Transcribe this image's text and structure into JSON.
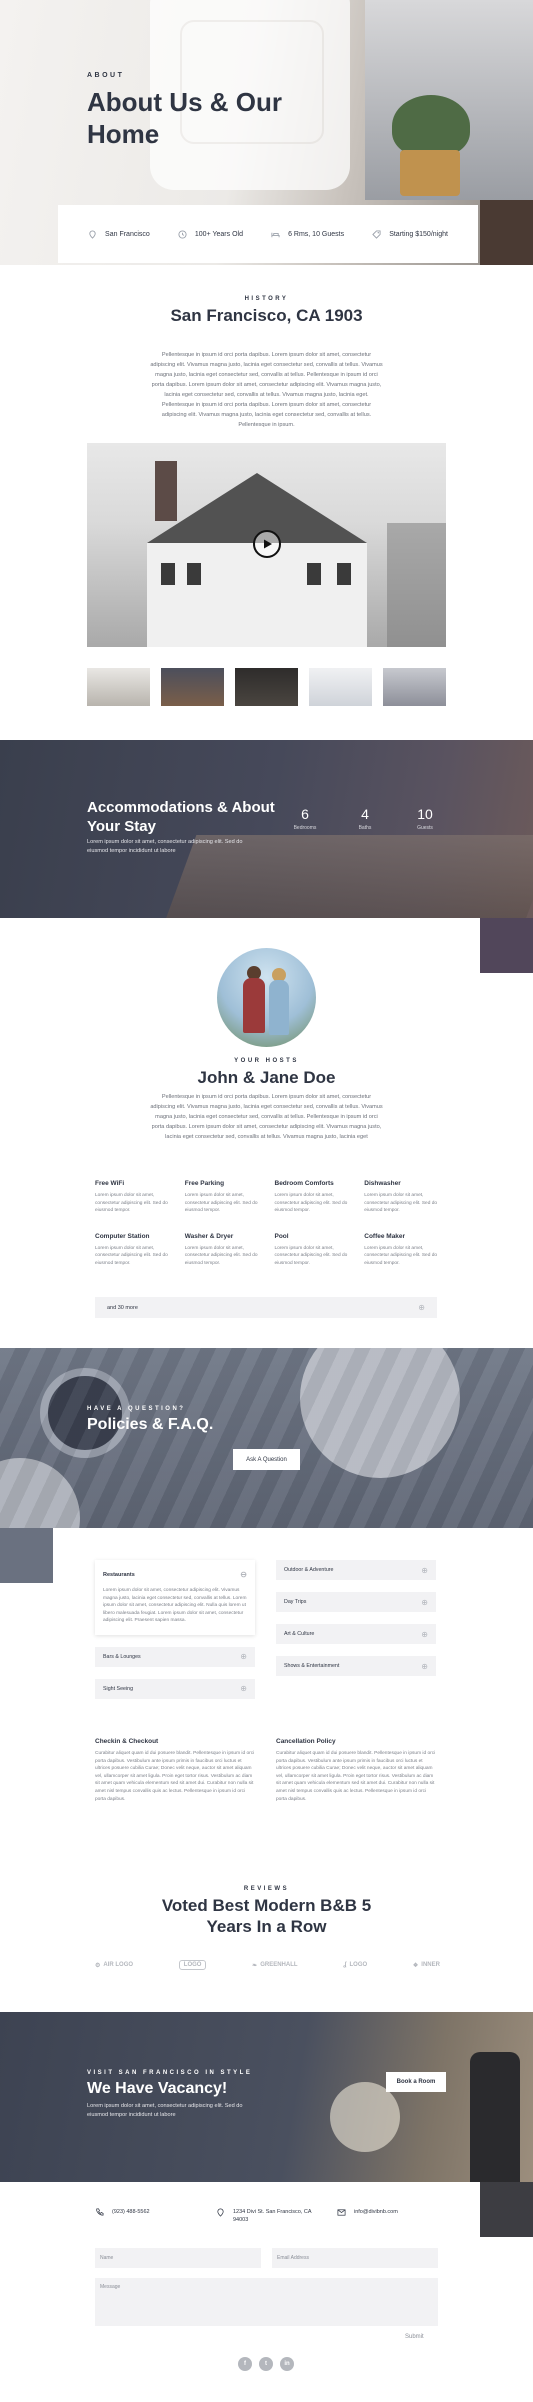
{
  "hero": {
    "overline": "ABOUT",
    "title": "About Us & Our Home"
  },
  "infobar": {
    "items": [
      {
        "icon": "map-pin-icon",
        "label": "San Francisco"
      },
      {
        "icon": "clock-icon",
        "label": "100+ Years Old"
      },
      {
        "icon": "bed-icon",
        "label": "6 Rms, 10 Guests"
      },
      {
        "icon": "tag-icon",
        "label": "Starting $150/night"
      }
    ]
  },
  "history": {
    "overline": "HISTORY",
    "title": "San Francisco, CA 1903",
    "paragraph": "Pellentesque in ipsum id orci porta dapibus. Lorem ipsum dolor sit amet, consectetur adipiscing elit. Vivamus magna justo, lacinia eget consectetur sed, convallis at tellus. Vivamus magna justo, lacinia eget consectetur sed, convallis at tellus. Pellentesque in ipsum id orci porta dapibus. Lorem ipsum dolor sit amet, consectetur adipiscing elit. Vivamus magna justo, lacinia eget consectetur sed, convallis at tellus. Vivamus magna justo, lacinia eget. Pellentesque in ipsum id orci porta dapibus. Lorem ipsum dolor sit amet, consectetur adipiscing elit. Vivamus magna justo, lacinia eget consectetur sed, convallis at tellus. Pellentesque in ipsum."
  },
  "gallery_colors": [
    "#b8b4ad",
    "#7a5e49",
    "#4a4540",
    "#cfd3d9",
    "#8d8f99"
  ],
  "accommodations": {
    "title": "Accommodations & About Your Stay",
    "paragraph": "Lorem ipsum dolor sit amet, consectetur adipiscing elit. Sed do eiusmod tempor incididunt ut labore",
    "stats": [
      {
        "number": "6",
        "label": "Bedrooms"
      },
      {
        "number": "4",
        "label": "Baths"
      },
      {
        "number": "10",
        "label": "Guests"
      }
    ]
  },
  "hosts": {
    "overline": "YOUR HOSTS",
    "title": "John & Jane Doe",
    "paragraph": "Pellentesque in ipsum id orci porta dapibus. Lorem ipsum dolor sit amet, consectetur adipiscing elit. Vivamus magna justo, lacinia eget consectetur sed, convallis at tellus. Vivamus magna justo, lacinia eget consectetur sed, convallis at tellus. Pellentesque in ipsum id orci porta dapibus. Lorem ipsum dolor sit amet, consectetur adipiscing elit. Vivamus magna justo, lacinia eget consectetur sed, convallis at tellus. Vivamus magna justo, lacinia eget"
  },
  "amenities": [
    {
      "title": "Free WiFi",
      "text": "Lorem ipsum dolor sit amet, consectetur adipiscing elit. Sed do eiusmod tempor."
    },
    {
      "title": "Free Parking",
      "text": "Lorem ipsum dolor sit amet, consectetur adipiscing elit. Sed do eiusmod tempor."
    },
    {
      "title": "Bedroom Comforts",
      "text": "Lorem ipsum dolor sit amet, consectetur adipiscing elit. Sed do eiusmod tempor."
    },
    {
      "title": "Dishwasher",
      "text": "Lorem ipsum dolor sit amet, consectetur adipiscing elit. Sed do eiusmod tempor."
    },
    {
      "title": "Computer Station",
      "text": "Lorem ipsum dolor sit amet, consectetur adipiscing elit. Sed do eiusmod tempor."
    },
    {
      "title": "Washer & Dryer",
      "text": "Lorem ipsum dolor sit amet, consectetur adipiscing elit. Sed do eiusmod tempor."
    },
    {
      "title": "Pool",
      "text": "Lorem ipsum dolor sit amet, consectetur adipiscing elit. Sed do eiusmod tempor."
    },
    {
      "title": "Coffee Maker",
      "text": "Lorem ipsum dolor sit amet, consectetur adipiscing elit. Sed do eiusmod tempor."
    }
  ],
  "more_bar": {
    "label": "and 30 more"
  },
  "policies": {
    "overline": "HAVE A QUESTION?",
    "title": "Policies & F.A.Q.",
    "button": "Ask A Question"
  },
  "faq": {
    "open_item": {
      "title": "Restaurants",
      "text": "Lorem ipsum dolor sit amet, consectetur adipiscing elit. Vivamus magna justo, lacinia eget consectetur sed, convallis at tellus. Lorem ipsum dolor sit amet, consectetur adipiscing elit. Nulla quis lorem ut libero malesuada feugiat. Lorem ipsum dolor sit amet, consectetur adipiscing elit. Praesent sapien massa."
    },
    "left_items": [
      "Bars & Lounges",
      "Sight Seeing"
    ],
    "right_items": [
      "Outdoor & Adventure",
      "Day Trips",
      "Art & Culture",
      "Shows & Entertainment"
    ]
  },
  "policy_blocks": [
    {
      "title": "Checkin & Checkout",
      "text": "Curabitur aliquet quam id dui posuere blandit. Pellentesque in ipsum id orci porta dapibus. Vestibulum ante ipsum primis in faucibus orci luctus et ultrices posuere cubilia Curae; Donec velit neque, auctor sit amet aliquam vel, ullamcorper sit amet ligula. Proin eget tortor risus. Vestibulum ac diam sit amet quam vehicula elementum sed sit amet dui. Curabitur non nulla sit amet nisl tempus convallis quis ac lectus. Pellentesque in ipsum id orci porta dapibus."
    },
    {
      "title": "Cancellation Policy",
      "text": "Curabitur aliquet quam id dui posuere blandit. Pellentesque in ipsum id orci porta dapibus. Vestibulum ante ipsum primis in faucibus orci luctus et ultrices posuere cubilia Curae; Donec velit neque, auctor sit amet aliquam vel, ullamcorper sit amet ligula. Proin eget tortor risus. Vestibulum ac diam sit amet quam vehicula elementum sed sit amet dui. Curabitur non nulla sit amet nisl tempus convallis quis ac lectus. Pellentesque in ipsum id orci porta dapibus."
    }
  ],
  "reviews": {
    "overline": "REVIEWS",
    "title": "Voted Best Modern B&B 5 Years In a Row",
    "logos": [
      "AIR LOGO",
      "LOGO",
      "GREENHALL",
      "LOGO",
      "INNER"
    ]
  },
  "vacancy": {
    "overline": "VISIT SAN FRANCISCO IN STYLE",
    "title": "We Have Vacancy!",
    "paragraph": "Lorem ipsum dolor sit amet, consectetur adipiscing elit. Sed do eiusmod tempor incididunt ut labore",
    "button": "Book a Room"
  },
  "contact": {
    "phone": "(923) 488-5562",
    "address": "1234 Divi St. San Francisco, CA 94003",
    "email": "info@divibnb.com",
    "name_placeholder": "Name",
    "email_placeholder": "Email Address",
    "message_placeholder": "Message",
    "submit": "Submit"
  },
  "social": [
    "f",
    "t",
    "in"
  ],
  "colors": {
    "text": "#2f3543",
    "muted": "#7d818a",
    "panel": "#f2f2f4",
    "banner_dark": "#3d4352"
  }
}
